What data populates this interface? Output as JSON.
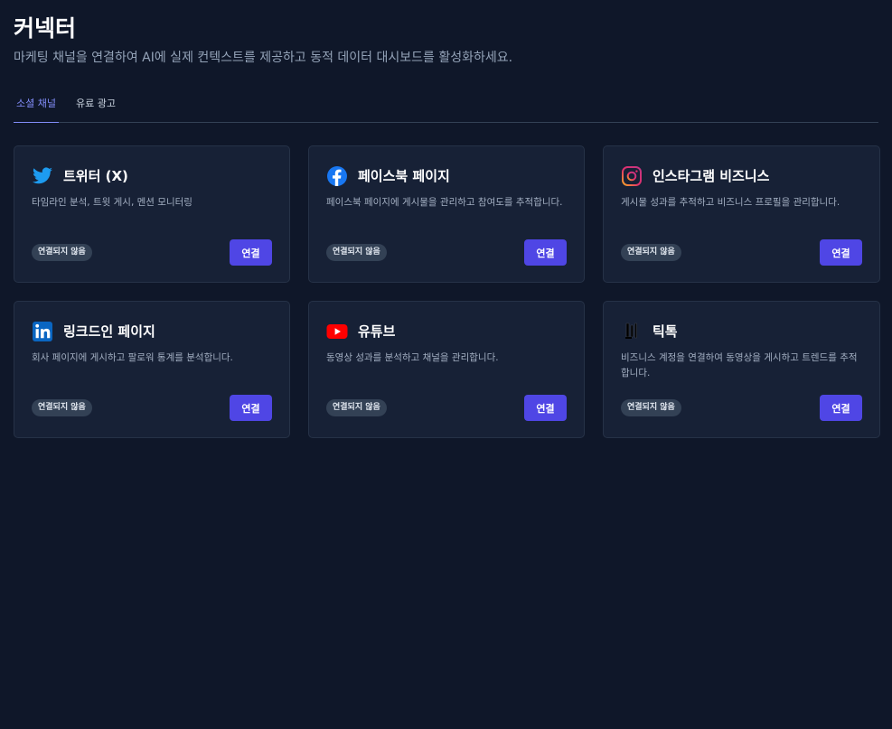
{
  "page": {
    "title": "커넥터",
    "subtitle": "마케팅 채널을 연결하여 AI에 실제 컨텍스트를 제공하고 동적 데이터 대시보드를 활성화하세요."
  },
  "tabs": [
    {
      "label": "소셜 채널",
      "active": true
    },
    {
      "label": "유료 광고",
      "active": false
    }
  ],
  "connectors": [
    {
      "name": "트위터 (X)",
      "icon": "twitter-icon",
      "description": "타임라인 분석, 트윗 게시, 멘션 모니터링",
      "status": "연결되지 않음",
      "button": "연결"
    },
    {
      "name": "페이스북 페이지",
      "icon": "facebook-icon",
      "description": "페이스북 페이지에 게시물을 관리하고 참여도를 추적합니다.",
      "status": "연결되지 않음",
      "button": "연결"
    },
    {
      "name": "인스타그램 비즈니스",
      "icon": "instagram-icon",
      "description": "게시물 성과를 추적하고 비즈니스 프로필을 관리합니다.",
      "status": "연결되지 않음",
      "button": "연결"
    },
    {
      "name": "링크드인 페이지",
      "icon": "linkedin-icon",
      "description": "회사 페이지에 게시하고 팔로워 통계를 분석합니다.",
      "status": "연결되지 않음",
      "button": "연결"
    },
    {
      "name": "유튜브",
      "icon": "youtube-icon",
      "description": "동영상 성과를 분석하고 채널을 관리합니다.",
      "status": "연결되지 않음",
      "button": "연결"
    },
    {
      "name": "틱톡",
      "icon": "tiktok-icon",
      "description": "비즈니스 계정을 연결하여 동영상을 게시하고 트렌드를 추적합니다.",
      "status": "연결되지 않음",
      "button": "연결"
    }
  ],
  "colors": {
    "background": "#0f1729",
    "card": "#172136",
    "accent": "#4f46e5",
    "tab_active": "#818cf8",
    "twitter": "#1d9bf0",
    "facebook": "#1877f2",
    "linkedin": "#0a66c2",
    "youtube": "#ff0000"
  }
}
